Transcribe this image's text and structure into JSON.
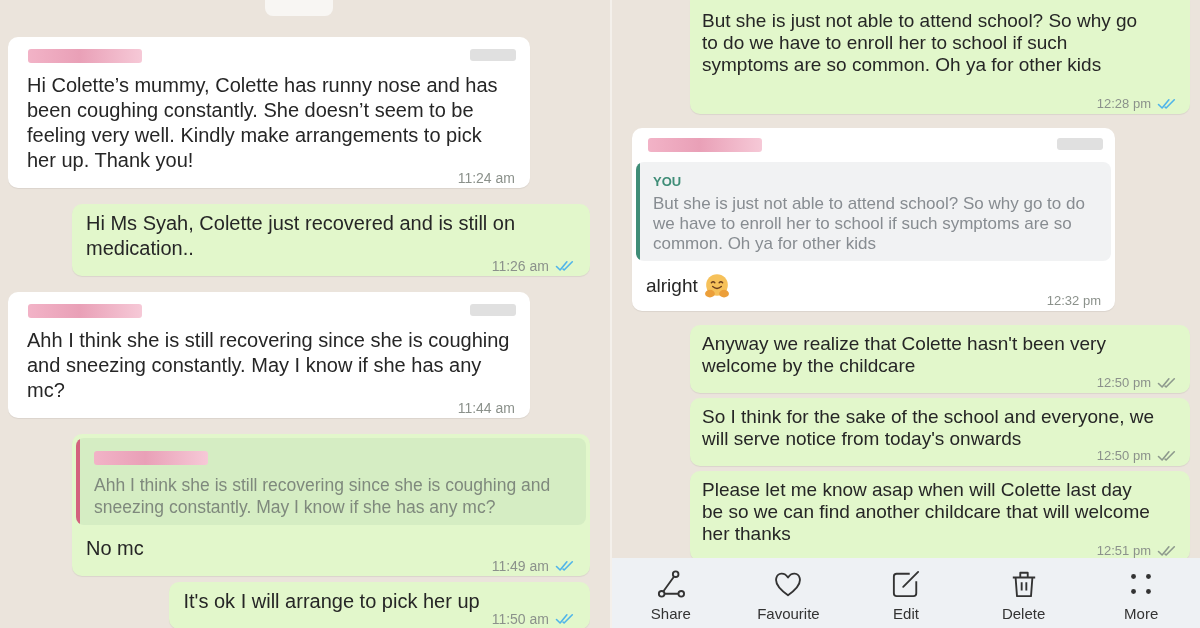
{
  "screenshots": [
    {
      "date_divider": true,
      "messages": [
        {
          "kind": "incoming",
          "sender_hidden": true,
          "text": "Hi Colette’s mummy, Colette has runny nose and has been coughing constantly. She doesn’t seem to be feeling very well. Kindly make arrangements to pick her up. Thank you!",
          "time": "11:24 am"
        },
        {
          "kind": "outgoing",
          "text": "Hi Ms Syah, Colette just recovered and is still on medication..",
          "time": "11:26 am",
          "read": true
        },
        {
          "kind": "incoming",
          "sender_hidden": true,
          "text": "Ahh I think she is still recovering since she is coughing and sneezing constantly. May I know if she has any mc?",
          "time": "11:44 am"
        },
        {
          "kind": "outgoing",
          "quote": {
            "sender_hidden": true,
            "color": "#d3627e",
            "text": "Ahh I think she is still recovering since she is coughing and sneezing constantly. May I know if she has any mc?"
          },
          "text": "No mc",
          "time": "11:49 am",
          "read": true
        },
        {
          "kind": "outgoing",
          "text": "It's ok I will arrange to pick her up",
          "time": "11:50 am",
          "read": true
        }
      ]
    },
    {
      "messages": [
        {
          "kind": "outgoing",
          "text": "But she is just not able to attend school? So why go to do we have to enroll her to school if such symptoms are so common. Oh ya for other kids",
          "time": "12:28 pm",
          "read": true
        },
        {
          "kind": "incoming",
          "sender_hidden": true,
          "quote": {
            "sender": "YOU",
            "color": "#3f8d77",
            "text": "But she is just not able to attend school? So why go to do we have to enroll her to school if such symptoms are so common. Oh ya for other kids"
          },
          "text": "alright",
          "emoji": true,
          "time": "12:32 pm"
        },
        {
          "kind": "outgoing",
          "text": "Anyway we realize that Colette hasn't been very welcome by the childcare",
          "time": "12:50 pm",
          "read": false
        },
        {
          "kind": "outgoing",
          "text": "So I think for the sake of the school and everyone, we will serve notice from today's onwards",
          "time": "12:50 pm",
          "read": false
        },
        {
          "kind": "outgoing",
          "text": "Please let me know asap when will Colette last day be so we can find another childcare that will welcome her thanks",
          "time": "12:51 pm",
          "read": false
        }
      ],
      "action_bar": [
        {
          "kind": "share",
          "label": "Share"
        },
        {
          "kind": "favourite",
          "label": "Favourite"
        },
        {
          "kind": "edit",
          "label": "Edit"
        },
        {
          "kind": "delete",
          "label": "Delete"
        },
        {
          "kind": "more",
          "label": "More"
        }
      ]
    }
  ]
}
